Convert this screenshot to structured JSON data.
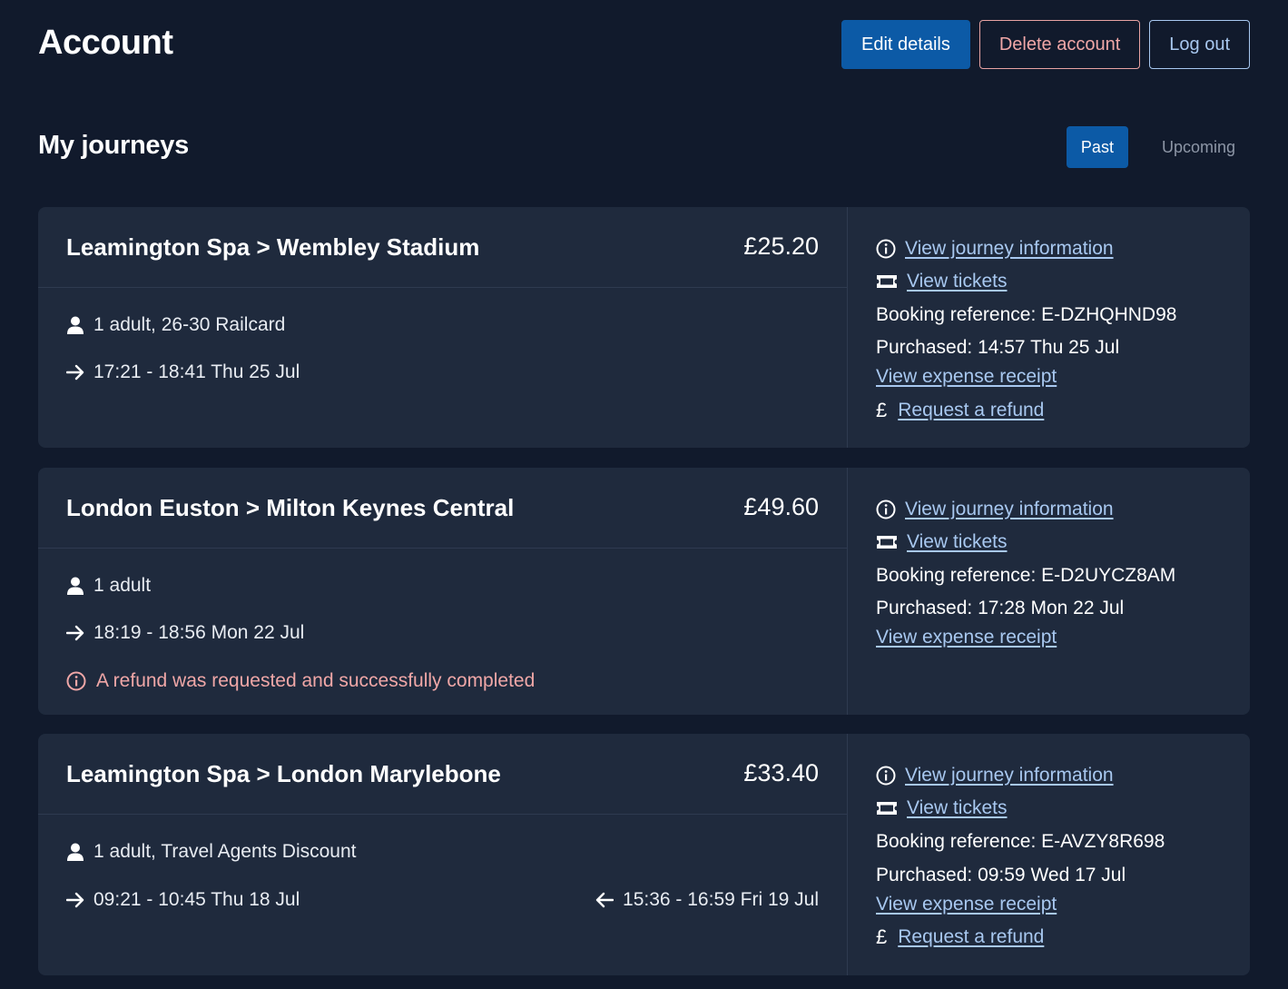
{
  "header": {
    "title": "Account",
    "edit_label": "Edit details",
    "delete_label": "Delete account",
    "logout_label": "Log out"
  },
  "section": {
    "title": "My journeys",
    "tabs": [
      {
        "label": "Past",
        "active": true
      },
      {
        "label": "Upcoming",
        "active": false
      }
    ]
  },
  "journeys": [
    {
      "route": "Leamington Spa > Wembley Stadium",
      "price": "£25.20",
      "passengers": "1 adult, 26-30 Railcard",
      "outbound": "17:21 - 18:41 Thu 25 Jul",
      "view_info_label": "View journey information",
      "view_tickets_label": "View tickets",
      "booking_reference": "Booking reference: E-DZHQHND98",
      "purchased": "Purchased: 14:57 Thu 25 Jul",
      "receipt_label": "View expense receipt",
      "refund_label": "Request a refund"
    },
    {
      "route": "London Euston > Milton Keynes Central",
      "price": "£49.60",
      "passengers": "1 adult",
      "outbound": "18:19 - 18:56 Mon 22 Jul",
      "refund_note": "A refund was requested and successfully completed",
      "view_info_label": "View journey information",
      "view_tickets_label": "View tickets",
      "booking_reference": "Booking reference: E-D2UYCZ8AM",
      "purchased": "Purchased: 17:28 Mon 22 Jul",
      "receipt_label": "View expense receipt"
    },
    {
      "route": "Leamington Spa > London Marylebone",
      "price": "£33.40",
      "passengers": "1 adult, Travel Agents Discount",
      "outbound": "09:21 - 10:45 Thu 18 Jul",
      "return": "15:36 - 16:59 Fri 19 Jul",
      "view_info_label": "View journey information",
      "view_tickets_label": "View tickets",
      "booking_reference": "Booking reference: E-AVZY8R698",
      "purchased": "Purchased: 09:59 Wed 17 Jul",
      "receipt_label": "View expense receipt",
      "refund_label": "Request a refund"
    }
  ],
  "icons": {
    "person": "person-icon",
    "arrow_right": "arrow-right-icon",
    "arrow_left": "arrow-left-icon",
    "info": "info-icon",
    "ticket": "ticket-icon",
    "pound": "£"
  },
  "colors": {
    "background": "#111a2c",
    "card": "#1f2a3d",
    "primary": "#0c5aa6",
    "link": "#a8c8f0",
    "danger": "#f0a7a7"
  }
}
